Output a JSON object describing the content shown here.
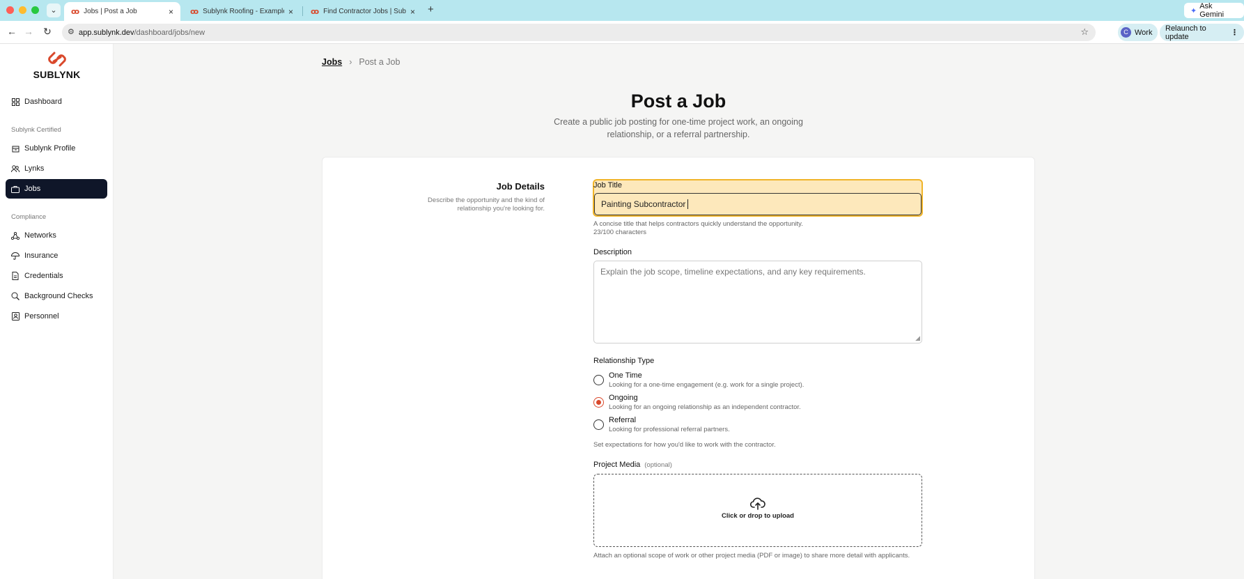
{
  "browser": {
    "tabs": [
      {
        "title": "Jobs | Post a Job",
        "active": true
      },
      {
        "title": "Sublynk Roofing - Example O",
        "active": false
      },
      {
        "title": "Find Contractor Jobs | Sublyn",
        "active": false
      }
    ],
    "new_tab_label": "+",
    "tab_menu_label": "⌄",
    "ask_gemini_label": "Ask Gemini",
    "url_host": "app.sublynk.dev",
    "url_path": "/dashboard/jobs/new",
    "profile_initial": "C",
    "profile_label": "Work",
    "relaunch_label": "Relaunch to update",
    "accent_colors": {
      "red": "#ff5f57",
      "yellow": "#febc2e",
      "green": "#28c840",
      "tabstrip": "#b7e7ef"
    }
  },
  "sidebar": {
    "logo_text": "SUBLYNK",
    "items": [
      {
        "label": "Dashboard",
        "icon": "grid-icon",
        "active": false
      },
      {
        "label": "Sublynk Profile",
        "icon": "building-icon",
        "active": false
      },
      {
        "label": "Lynks",
        "icon": "users-icon",
        "active": false
      },
      {
        "label": "Jobs",
        "icon": "briefcase-icon",
        "active": true
      },
      {
        "label": "Networks",
        "icon": "network-icon",
        "active": false
      },
      {
        "label": "Insurance",
        "icon": "umbrella-icon",
        "active": false
      },
      {
        "label": "Credentials",
        "icon": "document-icon",
        "active": false
      },
      {
        "label": "Background Checks",
        "icon": "search-icon",
        "active": false
      },
      {
        "label": "Personnel",
        "icon": "id-card-icon",
        "active": false
      }
    ],
    "sections": [
      "Sublynk Certified",
      "Compliance"
    ]
  },
  "breadcrumb": {
    "parent": "Jobs",
    "separator": "›",
    "current": "Post a Job"
  },
  "page": {
    "title": "Post a Job",
    "subtitle": "Create a public job posting for one-time project work, an ongoing relationship, or a referral partnership."
  },
  "form": {
    "section_title": "Job Details",
    "section_desc": "Describe the opportunity and the kind of relationship you're looking for.",
    "job_title": {
      "label": "Job Title",
      "value": "Painting Subcontractor",
      "help": "A concise title that helps contractors quickly understand the opportunity.",
      "count": "23/100 characters"
    },
    "description": {
      "label": "Description",
      "placeholder": "Explain the job scope, timeline expectations, and any key requirements."
    },
    "relationship": {
      "label": "Relationship Type",
      "options": [
        {
          "title": "One Time",
          "desc": "Looking for a one-time engagement (e.g. work for a single project).",
          "checked": false
        },
        {
          "title": "Ongoing",
          "desc": "Looking for an ongoing relationship as an independent contractor.",
          "checked": true
        },
        {
          "title": "Referral",
          "desc": "Looking for professional referral partners.",
          "checked": false
        }
      ],
      "help": "Set expectations for how you'd like to work with the contractor."
    },
    "media": {
      "label": "Project Media",
      "optional": "(optional)",
      "upload_text": "Click or drop to upload",
      "help": "Attach an optional scope of work or other project media (PDF or image) to share more detail with applicants."
    }
  }
}
